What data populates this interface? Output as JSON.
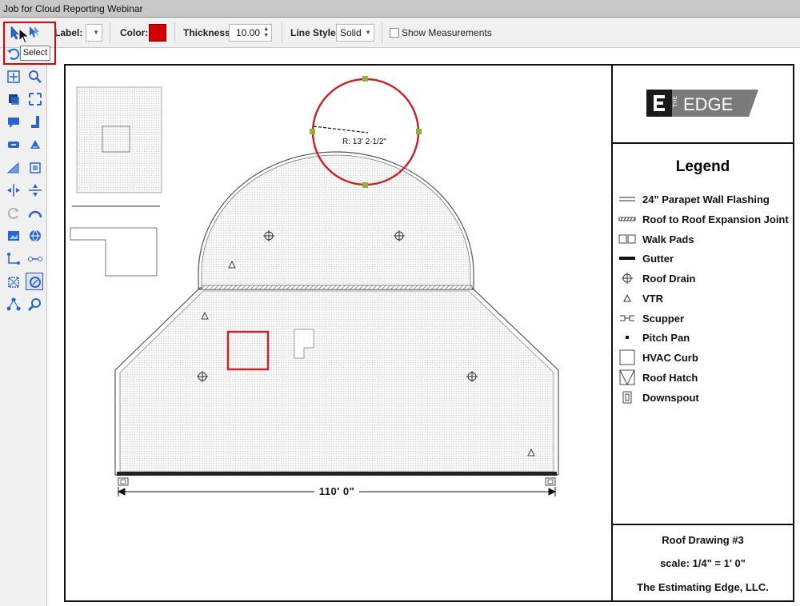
{
  "window": {
    "title": "Job for Cloud Reporting Webinar"
  },
  "toolbar": {
    "label_label": "Label:",
    "color_label": "Color:",
    "color_value": "#d40000",
    "thickness_label": "Thickness:",
    "thickness_value": "10.00",
    "line_style_label": "Line Style:",
    "line_style_value": "Solid",
    "show_measurements_label": "Show Measurements",
    "show_measurements_checked": false
  },
  "tooltip": {
    "text": "Select"
  },
  "left_tools": [
    "select-arrow-icon",
    "select-multi-icon",
    "undo-icon",
    "fit-view-icon",
    "zoom-icon",
    "layer-icon",
    "expand-icon",
    "comment-icon",
    "drain-tool-icon",
    "scupper-tool-icon",
    "fill-icon",
    "ramp-icon",
    "square-tool-icon",
    "split-icon",
    "divide-icon",
    "rotate-icon",
    "arc-icon",
    "image-icon",
    "globe-icon",
    "polyline-icon",
    "line-tool-icon",
    "crop-icon",
    "target-icon",
    "network-icon",
    "magnifier-icon"
  ],
  "legend": {
    "title": "Legend",
    "items": [
      {
        "label": "24\" Parapet Wall Flashing",
        "icon": "parapet-icon"
      },
      {
        "label": "Roof to Roof Expansion Joint",
        "icon": "expansion-joint-icon"
      },
      {
        "label": "Walk Pads",
        "icon": "walk-pads-icon"
      },
      {
        "label": "Gutter",
        "icon": "gutter-icon"
      },
      {
        "label": "Roof Drain",
        "icon": "roof-drain-icon"
      },
      {
        "label": "VTR",
        "icon": "vtr-icon"
      },
      {
        "label": "Scupper",
        "icon": "scupper-icon"
      },
      {
        "label": "Pitch Pan",
        "icon": "pitch-pan-icon"
      },
      {
        "label": "HVAC Curb",
        "icon": "hvac-curb-icon"
      },
      {
        "label": "Roof Hatch",
        "icon": "roof-hatch-icon"
      },
      {
        "label": "Downspout",
        "icon": "downspout-icon"
      }
    ]
  },
  "logo": {
    "brand_small": "THE",
    "brand_large": "EDGE"
  },
  "title_block": {
    "drawing_name": "Roof Drawing #3",
    "scale": "scale: 1/4\" = 1' 0\"",
    "company": "The Estimating Edge, LLC."
  },
  "drawing": {
    "dimension_label": "110' 0\"",
    "radius_label": "R: 13' 2-1/2\"",
    "selection_color": "#c0292b",
    "handle_color": "#8db33a"
  }
}
